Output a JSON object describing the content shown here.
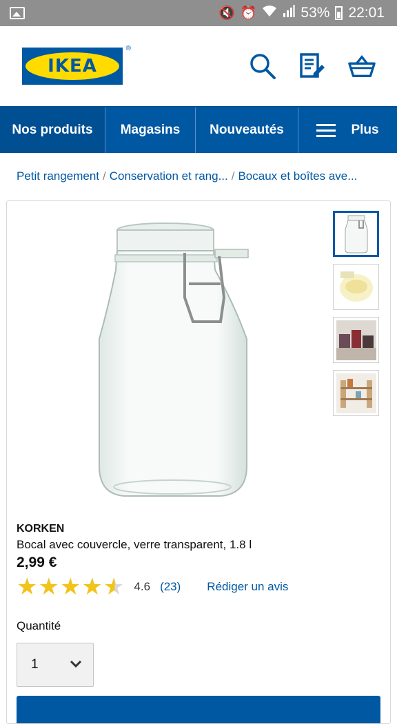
{
  "status_bar": {
    "battery": "53%",
    "time": "22:01"
  },
  "header": {
    "logo_text": "IKEA",
    "logo_reg": "®"
  },
  "nav": {
    "items": [
      {
        "label": "Nos produits"
      },
      {
        "label": "Magasins"
      },
      {
        "label": "Nouveautés"
      },
      {
        "label": "Plus"
      }
    ]
  },
  "breadcrumb": {
    "items": [
      "Petit rangement",
      "Conservation et rang...",
      "Bocaux et boîtes ave..."
    ],
    "separator": "/"
  },
  "product": {
    "name": "KORKEN",
    "description": "Bocal avec couvercle, verre transparent, 1.8 l",
    "price": "2,99 €",
    "rating": 4.6,
    "rating_text": "4.6",
    "review_count": "(23)",
    "write_review": "Rédiger un avis",
    "quantity_label": "Quantité",
    "quantity_value": "1"
  },
  "colors": {
    "brand_blue": "#0058a3",
    "brand_yellow": "#ffdb00",
    "star": "#f2c31b"
  }
}
